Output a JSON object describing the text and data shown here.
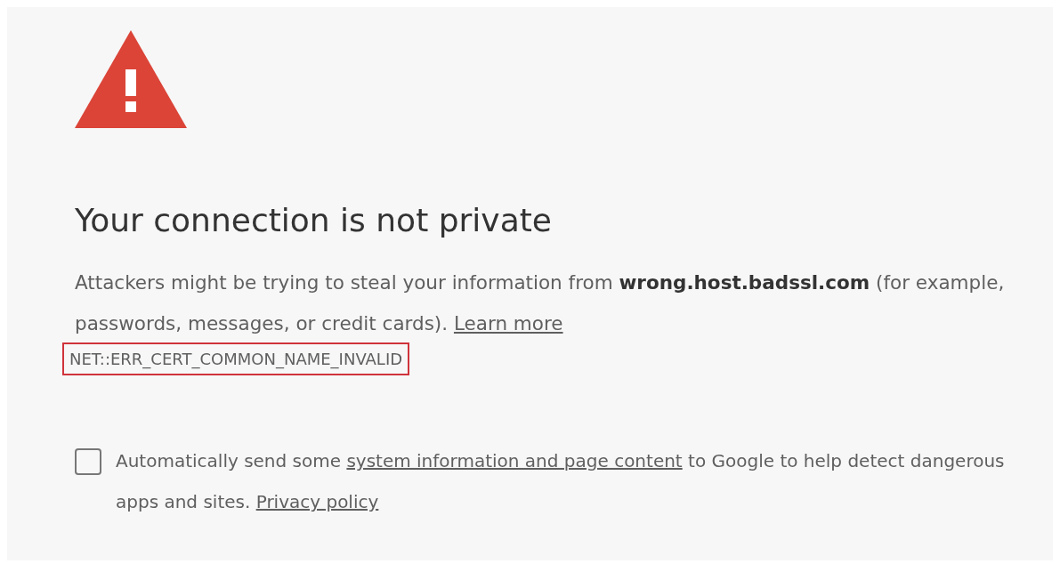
{
  "heading": "Your connection is not private",
  "description": {
    "text": "Attackers might be trying to steal your information from **wrong.host.badssl.com** (for example, passwords, messages, or credit cards).",
    "link": "Learn more"
  },
  "error_code": {
    "text": "NET::ERR_CERT_COMMON_NAME_INVALID",
    "highlighted": true
  },
  "report": {
    "checked": false,
    "parts": [
      {
        "kind": "text",
        "text": "Automatically send some"
      },
      {
        "kind": "link",
        "text": "system information and page content"
      },
      {
        "kind": "text",
        "text": "to Google to help detect dangerous apps and sites."
      },
      {
        "kind": "link",
        "text": "Privacy policy"
      }
    ]
  }
}
